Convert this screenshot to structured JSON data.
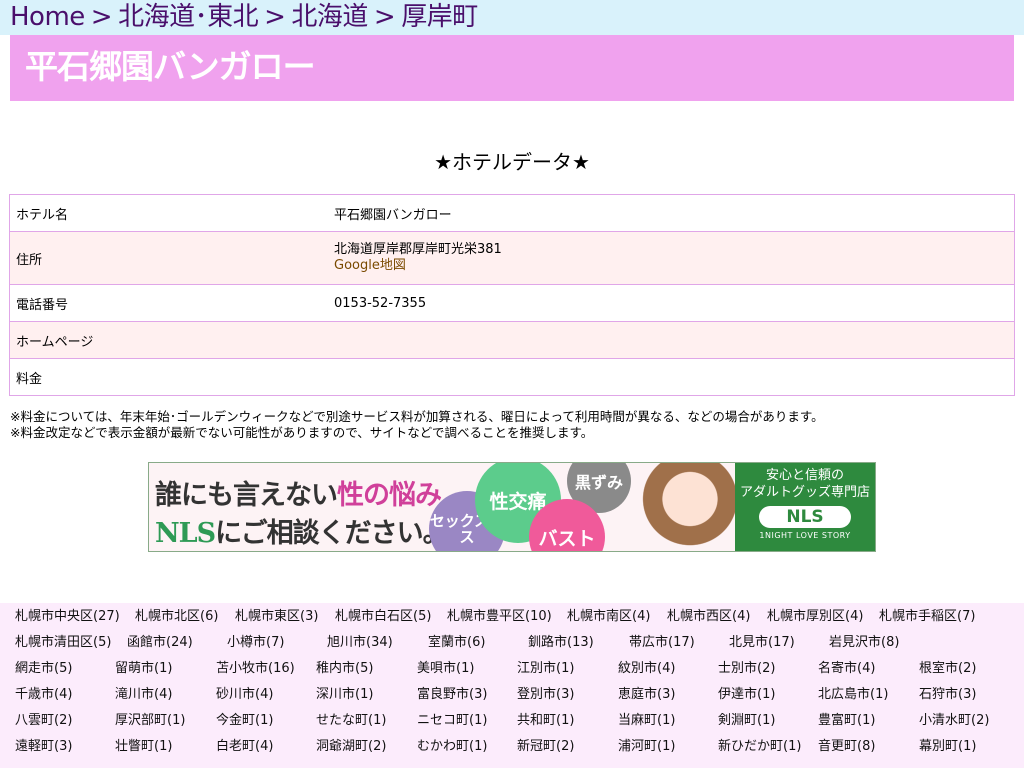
{
  "breadcrumb": {
    "items": [
      "Home",
      "北海道･東北",
      "北海道",
      "厚岸町"
    ],
    "separator": ">"
  },
  "page_title": "平石郷園バンガロー",
  "section_heading": "★ホテルデータ★",
  "hotel_table": {
    "rows": [
      {
        "label": "ホテル名",
        "value": "平石郷園バンガロー"
      },
      {
        "label": "住所",
        "value": "北海道厚岸郡厚岸町光栄381",
        "link": "Google地図"
      },
      {
        "label": "電話番号",
        "value": "0153-52-7355"
      },
      {
        "label": "ホームページ",
        "value": ""
      },
      {
        "label": "料金",
        "value": ""
      }
    ]
  },
  "notes": [
    "※料金については、年末年始･ゴールデンウィークなどで別途サービス料が加算される、曜日によって利用時間が異なる、などの場合があります。",
    "※料金改定などで表示金額が最新でない可能性がありますので、サイトなどで調べることを推奨します。"
  ],
  "banner": {
    "line1_a": "誰にも言えない",
    "line1_b": "性の悩み",
    "line2_a": "NLS",
    "line2_b": "にご相談ください。",
    "bubble1": "性交痛",
    "bubble2": "黒ずみ",
    "bubble3": "セックスレス",
    "bubble4": "バスト",
    "panel_line1": "安心と信頼の",
    "panel_line2": "アダルトグッズ専門店",
    "logo": "NLS",
    "tagline": "1NIGHT LOVE STORY"
  },
  "area_rows": [
    [
      "札幌市中央区(27)",
      "札幌市北区(6)",
      "札幌市東区(3)",
      "札幌市白石区(5)",
      "札幌市豊平区(10)",
      "札幌市南区(4)",
      "札幌市西区(4)",
      "札幌市厚別区(4)",
      "札幌市手稲区(7)"
    ],
    [
      "札幌市清田区(5)",
      "函館市(24)",
      "小樽市(7)",
      "旭川市(34)",
      "室蘭市(6)",
      "釧路市(13)",
      "帯広市(17)",
      "北見市(17)",
      "岩見沢市(8)"
    ],
    [
      "網走市(5)",
      "留萌市(1)",
      "苫小牧市(16)",
      "稚内市(5)",
      "美唄市(1)",
      "江別市(1)",
      "紋別市(4)",
      "士別市(2)",
      "名寄市(4)",
      "根室市(2)"
    ],
    [
      "千歳市(4)",
      "滝川市(4)",
      "砂川市(4)",
      "深川市(1)",
      "富良野市(3)",
      "登別市(3)",
      "恵庭市(3)",
      "伊達市(1)",
      "北広島市(1)",
      "石狩市(3)"
    ],
    [
      "八雲町(2)",
      "厚沢部町(1)",
      "今金町(1)",
      "せたな町(1)",
      "ニセコ町(1)",
      "共和町(1)",
      "当麻町(1)",
      "剣淵町(1)",
      "豊富町(1)",
      "小清水町(2)"
    ],
    [
      "遠軽町(3)",
      "壮瞥町(1)",
      "白老町(4)",
      "洞爺湖町(2)",
      "むかわ町(1)",
      "新冠町(2)",
      "浦河町(1)",
      "新ひだか町(1)",
      "音更町(8)",
      "幕別町(1)"
    ]
  ]
}
